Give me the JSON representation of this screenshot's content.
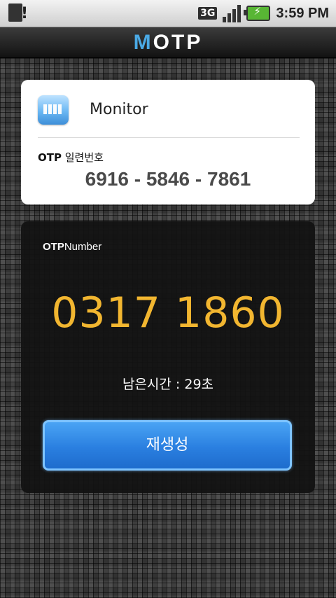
{
  "status_bar": {
    "network": "3G",
    "time": "3:59 PM",
    "icons": [
      "sd-card-alert-icon",
      "3g-icon",
      "signal-icon",
      "battery-charging-icon"
    ]
  },
  "app_bar": {
    "title_first": "M",
    "title_rest": "OTP",
    "accent_color": "#4aa9e4"
  },
  "info_card": {
    "service_name": "Monitor",
    "serial_label_bold": "OTP",
    "serial_label_rest": " 일련번호",
    "serial_number": "6916 - 5846 - 7861"
  },
  "otp_panel": {
    "label_bold": "OTP",
    "label_rest": "Number",
    "otp_value": "0317 1860",
    "otp_color": "#f2b630",
    "time_left": "남은시간 : 29초",
    "regenerate_label": "재생성"
  }
}
